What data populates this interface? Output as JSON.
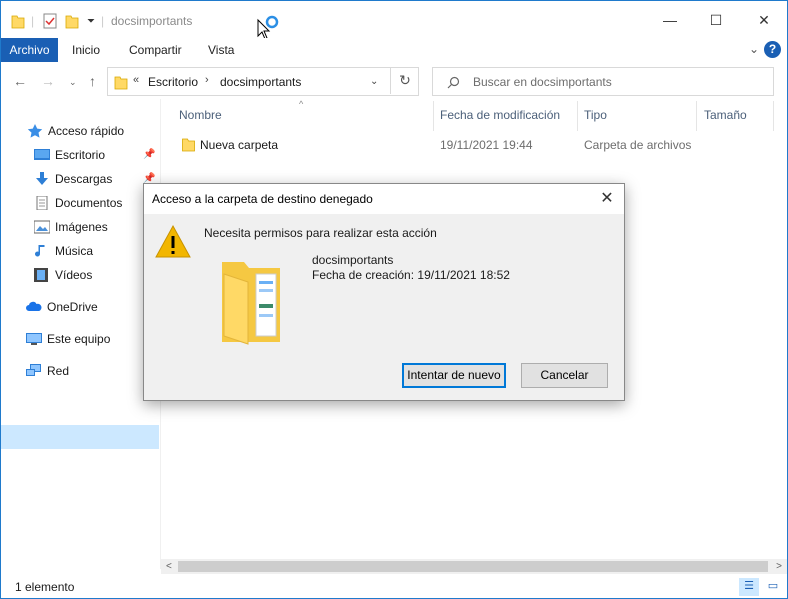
{
  "window": {
    "title": "docsimportants",
    "controls": {
      "minimize": "—",
      "maximize": "☐",
      "close": "✕"
    }
  },
  "ribbon": {
    "tabs": [
      "Archivo",
      "Inicio",
      "Compartir",
      "Vista"
    ],
    "help": "?"
  },
  "address_bar": {
    "overflow": "«",
    "crumbs": [
      "Escritorio",
      "docsimportants"
    ],
    "separator": "›"
  },
  "search": {
    "placeholder": "Buscar en docsimportants"
  },
  "nav_pane": {
    "items": [
      {
        "label": "Acceso rápido",
        "icon": "star-icon"
      },
      {
        "label": "Escritorio",
        "icon": "desktop-icon",
        "pinned": true
      },
      {
        "label": "Descargas",
        "icon": "download-icon",
        "pinned": true
      },
      {
        "label": "Documentos",
        "icon": "document-icon"
      },
      {
        "label": "Imágenes",
        "icon": "pictures-icon"
      },
      {
        "label": "Música",
        "icon": "music-icon"
      },
      {
        "label": "Vídeos",
        "icon": "video-icon"
      },
      {
        "label": "OneDrive",
        "icon": "cloud-icon"
      },
      {
        "label": "Este equipo",
        "icon": "computer-icon",
        "selected": true
      },
      {
        "label": "Red",
        "icon": "network-icon"
      }
    ]
  },
  "file_list": {
    "columns": [
      "Nombre",
      "Fecha de modificación",
      "Tipo",
      "Tamaño"
    ],
    "rows": [
      {
        "name": "Nueva carpeta",
        "modified": "19/11/2021 19:44",
        "type": "Carpeta de archivos",
        "size": ""
      }
    ]
  },
  "status_bar": {
    "count": "1 elemento"
  },
  "dialog": {
    "title": "Acceso a la carpeta de destino denegado",
    "message": "Necesita permisos para realizar esta acción",
    "item_name": "docsimportants",
    "item_date": "Fecha de creación: 19/11/2021 18:52",
    "retry_label": "Intentar de nuevo",
    "cancel_label": "Cancelar",
    "close": "✕"
  },
  "colors": {
    "accent": "#1a5fb4",
    "selection": "#cce8ff",
    "folder": "#ffd966",
    "warning": "#f2b600"
  }
}
